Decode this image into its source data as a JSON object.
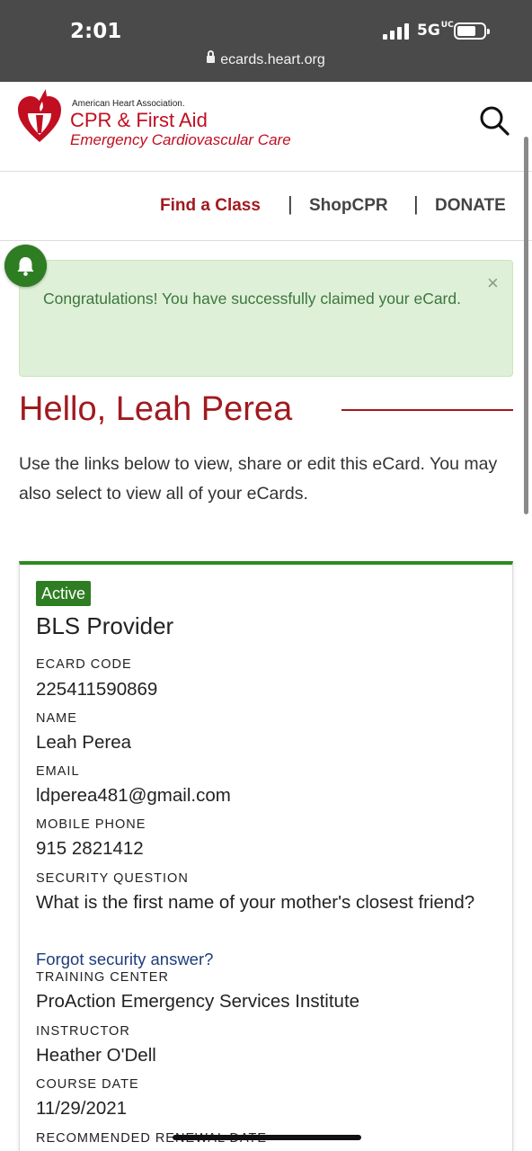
{
  "status_bar": {
    "time": "2:01",
    "network": "5G",
    "network_suffix": "UC"
  },
  "browser": {
    "url": "ecards.heart.org"
  },
  "header": {
    "org_name": "American Heart Association.",
    "brand_title": "CPR & First Aid",
    "brand_subtitle": "Emergency Cardiovascular Care",
    "search_icon": "search-icon"
  },
  "nav": {
    "items": [
      {
        "label": "Find a Class",
        "color": "#a01a1f"
      },
      {
        "label": "ShopCPR",
        "color": "#444444"
      },
      {
        "label": "DONATE",
        "color": "#444444"
      }
    ],
    "separator": "|"
  },
  "alert": {
    "message": "Congratulations! You have successfully claimed your eCard.",
    "close": "×",
    "icon": "bell-icon"
  },
  "greeting": {
    "title": "Hello, Leah Perea",
    "intro": "Use the links below to view, share or edit this eCard. You may also select to view all of your eCards."
  },
  "card": {
    "status": "Active",
    "course": "BLS Provider",
    "fields": {
      "ecard_code_label": "ECARD CODE",
      "ecard_code": "225411590869",
      "name_label": "NAME",
      "name": "Leah Perea",
      "email_label": "EMAIL",
      "email": "ldperea481@gmail.com",
      "phone_label": "MOBILE PHONE",
      "phone": "915 2821412",
      "security_label": "SECURITY QUESTION",
      "security_question": "What is the first name of your mother's closest friend?",
      "forgot_link": "Forgot security answer?",
      "training_center_label": "TRAINING CENTER",
      "training_center": "ProAction Emergency Services Institute",
      "instructor_label": "INSTRUCTOR",
      "instructor": "Heather O'Dell",
      "course_date_label": "COURSE DATE",
      "course_date": "11/29/2021",
      "renewal_label": "RECOMMENDED RENEWAL DATE"
    }
  },
  "colors": {
    "brand_red": "#c10e21",
    "success_green": "#2e7d22",
    "alert_bg": "#dff0d8"
  }
}
